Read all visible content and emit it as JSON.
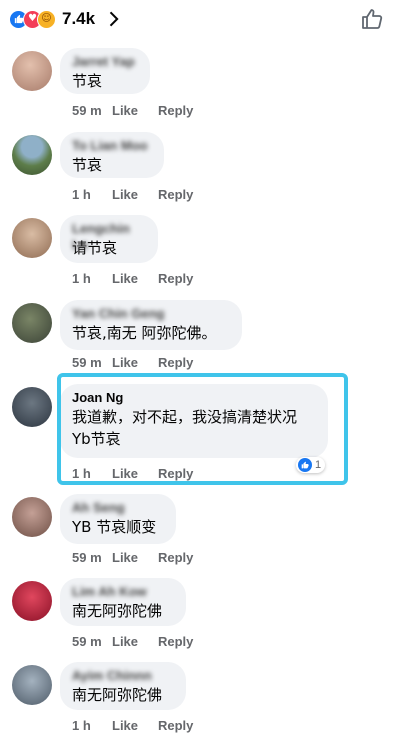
{
  "header": {
    "reaction_count": "7.4k",
    "reactions": [
      {
        "icon": "like-icon",
        "glyph": "👍"
      },
      {
        "icon": "love-icon",
        "glyph": "♥"
      },
      {
        "icon": "care-icon",
        "glyph": "☺"
      }
    ]
  },
  "comments": [
    {
      "name": "Jarret Yap",
      "name_blurred": true,
      "text": [
        "节哀"
      ],
      "time": "59 m",
      "like": "Like",
      "reply": "Reply",
      "avatar_color": "#c9a08e"
    },
    {
      "name": "To Lian Moo",
      "name_blurred": true,
      "text": [
        "节哀"
      ],
      "time": "1 h",
      "like": "Like",
      "reply": "Reply",
      "avatar_color": "#5d7d4a"
    },
    {
      "name": "Lengchin Lo",
      "name_blurred": true,
      "text": [
        "请节哀"
      ],
      "time": "1 h",
      "like": "Like",
      "reply": "Reply",
      "avatar_color": "#b59378"
    },
    {
      "name": "Yan Chin Geng",
      "name_blurred": true,
      "text": [
        "节哀,南无 阿弥陀佛。"
      ],
      "time": "59 m",
      "like": "Like",
      "reply": "Reply",
      "avatar_color": "#4a5443"
    },
    {
      "name": "Joan Ng",
      "name_blurred": false,
      "text": [
        "我道歉，对不起，我没搞清楚状况",
        "Yb节哀"
      ],
      "time": "1 h",
      "like": "Like",
      "reply": "Reply",
      "avatar_color": "#3d4a56",
      "reaction_count": "1"
    },
    {
      "name": "Ah Seng",
      "name_blurred": true,
      "text": [
        "YB 节哀顺变"
      ],
      "time": "59 m",
      "like": "Like",
      "reply": "Reply",
      "avatar_color": "#8f6f63"
    },
    {
      "name": "Lim Ah Kow",
      "name_blurred": true,
      "text": [
        "南无阿弥陀佛"
      ],
      "time": "59 m",
      "like": "Like",
      "reply": "Reply",
      "avatar_color": "#b0203a"
    },
    {
      "name": "Ayim Chinnn",
      "name_blurred": true,
      "text": [
        "南无阿弥陀佛"
      ],
      "time": "1 h",
      "like": "Like",
      "reply": "Reply",
      "avatar_color": "#6b7a8c"
    }
  ],
  "colors": {
    "accent": "#1877f2",
    "highlight": "#3fc4ea",
    "bubble": "#f0f2f5",
    "meta": "#65676b"
  }
}
